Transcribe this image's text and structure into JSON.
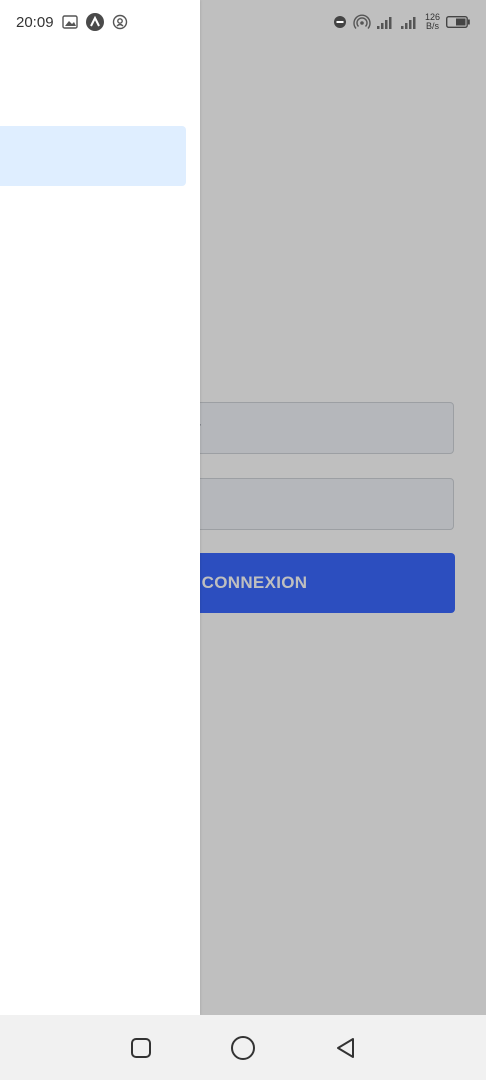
{
  "status_bar": {
    "time": "20:09",
    "net_speed_value": "126",
    "net_speed_unit": "B/s",
    "left_icons": [
      "image-icon",
      "app-badge-icon",
      "location-icon"
    ],
    "right_icons": [
      "dnd-icon",
      "hotspot-icon",
      "signal-icon",
      "signal-icon-2",
      "battery-icon"
    ]
  },
  "login": {
    "username_placeholder": "r",
    "password_placeholder": "",
    "button_label": "CONNEXION",
    "button_color": "#3b69ff"
  },
  "drawer": {
    "active_item_color": "#dfeeff"
  },
  "navbar": {
    "buttons": [
      "recents-icon",
      "home-icon",
      "back-icon"
    ]
  }
}
